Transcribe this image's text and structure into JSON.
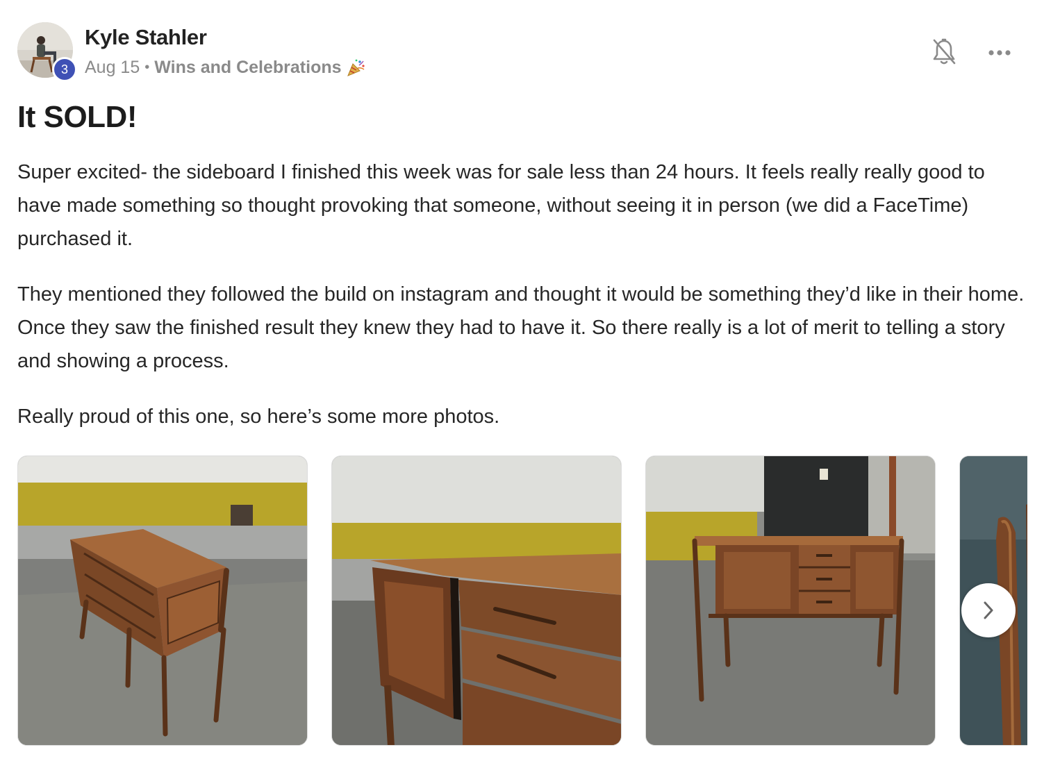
{
  "post": {
    "author": {
      "name": "Kyle Stahler",
      "level": "3"
    },
    "date": "Aug 15",
    "separator": "•",
    "category": "Wins and Celebrations",
    "category_icon": "party-popper-icon",
    "title": "It SOLD!",
    "paragraphs": [
      "Super excited- the sideboard I finished this week was for sale less than 24 hours. It feels really really good to have made something so thought provoking that someone, without seeing it in person (we did a FaceTime) purchased it.",
      "They mentioned they followed the build on instagram and thought it would be something they’d like in their home. Once they saw the finished result they knew they had to have it. So there really is a lot of merit to telling a story and showing a process.",
      "Really proud of this one, so here’s some more photos."
    ],
    "actions": {
      "notifications_icon": "bell-off-icon",
      "more_icon": "more-horizontal-icon",
      "next_icon": "chevron-right-icon"
    },
    "colors": {
      "level_badge": "#3f51b5",
      "wood": "#8a5530",
      "wall_yellow": "#b8a52a"
    }
  }
}
